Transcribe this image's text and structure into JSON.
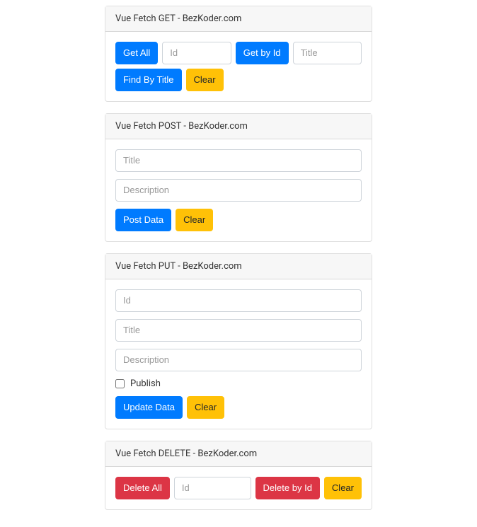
{
  "get": {
    "header": "Vue Fetch GET - BezKoder.com",
    "buttons": {
      "getAll": "Get All",
      "getById": "Get by Id",
      "findByTitle": "Find By Title",
      "clear": "Clear"
    },
    "placeholders": {
      "id": "Id",
      "title": "Title"
    }
  },
  "post": {
    "header": "Vue Fetch POST - BezKoder.com",
    "buttons": {
      "postData": "Post Data",
      "clear": "Clear"
    },
    "placeholders": {
      "title": "Title",
      "description": "Description"
    }
  },
  "put": {
    "header": "Vue Fetch PUT - BezKoder.com",
    "buttons": {
      "updateData": "Update Data",
      "clear": "Clear"
    },
    "placeholders": {
      "id": "Id",
      "title": "Title",
      "description": "Description"
    },
    "publishLabel": "Publish"
  },
  "delete": {
    "header": "Vue Fetch DELETE - BezKoder.com",
    "buttons": {
      "deleteAll": "Delete All",
      "deleteById": "Delete by Id",
      "clear": "Clear"
    },
    "placeholders": {
      "id": "Id"
    }
  }
}
